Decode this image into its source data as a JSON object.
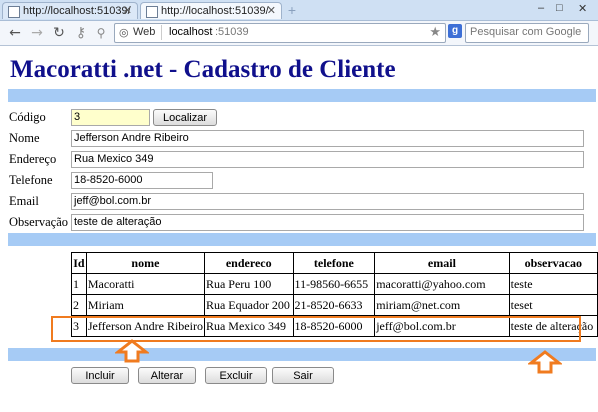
{
  "browser": {
    "tabs": [
      {
        "label": "http://localhost:51039/"
      },
      {
        "label": "http://localhost:51039/"
      }
    ],
    "url_host": "localhost",
    "url_port": ":51039",
    "site_label": "Web",
    "search_placeholder": "Pesquisar com Google"
  },
  "page": {
    "title": "Macoratti .net - Cadastro de Cliente"
  },
  "form": {
    "codigo": {
      "label": "Código",
      "value": "3"
    },
    "localizar_label": "Localizar",
    "nome": {
      "label": "Nome",
      "value": "Jefferson Andre Ribeiro"
    },
    "endereco": {
      "label": "Endereço",
      "value": "Rua Mexico 349"
    },
    "telefone": {
      "label": "Telefone",
      "value": "18-8520-6000"
    },
    "email": {
      "label": "Email",
      "value": "jeff@bol.com.br"
    },
    "observacao": {
      "label": "Observação",
      "value": "teste de alteração"
    }
  },
  "grid": {
    "columns": [
      "Id",
      "nome",
      "endereco",
      "telefone",
      "email",
      "observacao"
    ],
    "rows": [
      [
        "1",
        "Macoratti",
        "Rua Peru 100",
        "11-98560-6655",
        "macoratti@yahoo.com",
        "teste"
      ],
      [
        "2",
        "Miriam",
        "Rua Equador 200",
        "21-8520-6633",
        "miriam@net.com",
        "teset"
      ],
      [
        "3",
        "Jefferson Andre Ribeiro",
        "Rua Mexico 349",
        "18-8520-6000",
        "jeff@bol.com.br",
        "teste de alteração"
      ]
    ],
    "highlight_row": 3
  },
  "actions": {
    "incluir": "Incluir",
    "alterar": "Alterar",
    "excluir": "Excluir",
    "sair": "Sair"
  },
  "colors": {
    "title": "#10108c",
    "bar": "#a6cbf5",
    "highlight": "#f07b1f",
    "codigo_field": "#ffffcc"
  }
}
